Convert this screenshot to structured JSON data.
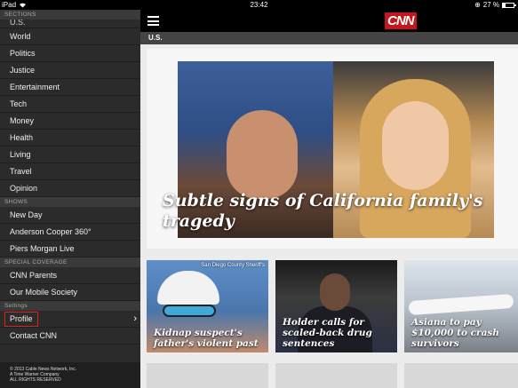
{
  "status_bar": {
    "device": "iPad",
    "time": "23:42",
    "battery_text": "27 %",
    "battery_level": 0.27
  },
  "sidebar": {
    "sections": [
      {
        "header": "Sections",
        "items": [
          "U.S.",
          "World",
          "Politics",
          "Justice",
          "Entertainment",
          "Tech",
          "Money",
          "Health",
          "Living",
          "Travel",
          "Opinion"
        ]
      },
      {
        "header": "Shows",
        "items": [
          "New Day",
          "Anderson Cooper 360°",
          "Piers Morgan Live"
        ]
      },
      {
        "header": "Special Coverage",
        "items": [
          "CNN Parents",
          "Our Mobile Society"
        ]
      },
      {
        "header": "Settings",
        "items": [
          "Profile",
          "Contact CNN"
        ]
      }
    ],
    "selected_item": "Profile",
    "footer": [
      "© 2013 Cable News Network, Inc.",
      "A Time Warner Company",
      "ALL RIGHTS RESERVED"
    ]
  },
  "header": {
    "logo": "CNN",
    "section_title": "U.S."
  },
  "hero": {
    "headline": "Subtle signs of California family's tragedy"
  },
  "cards": [
    {
      "caption": "Kidnap suspect's father's violent past",
      "credit": "San Diego County Sheriff's"
    },
    {
      "caption": "Holder calls for scaled-back drug sentences",
      "credit": ""
    },
    {
      "caption": "Asiana to pay $10,000 to crash survivors",
      "credit": ""
    }
  ],
  "colors": {
    "brand_red": "#c4161c",
    "sidebar_bg": "#2b2b2b",
    "highlight_box": "#d9261c"
  }
}
